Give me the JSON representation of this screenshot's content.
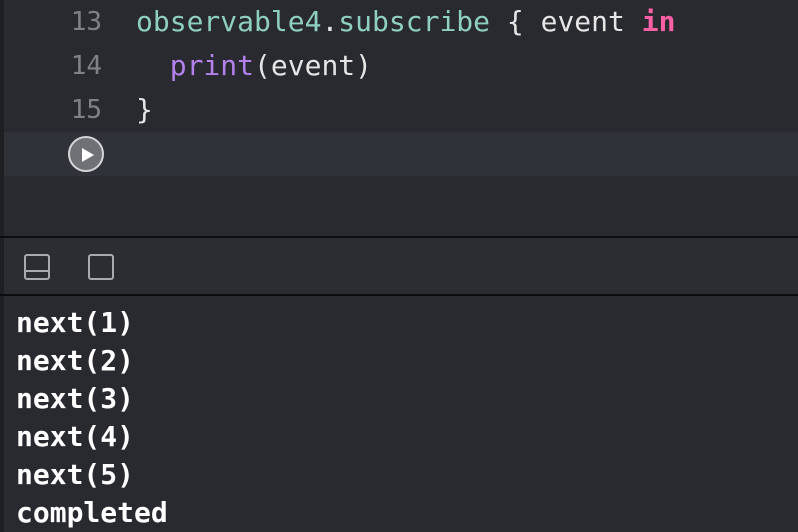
{
  "editor": {
    "lines": [
      {
        "number": "13",
        "tokens": {
          "receiver": "observable4",
          "dot": ".",
          "method": "subscribe",
          "brace": " { event ",
          "keyword": "in"
        }
      },
      {
        "number": "14",
        "tokens": {
          "indent": "  ",
          "func": "print",
          "args": "(event)"
        }
      },
      {
        "number": "15",
        "tokens": {
          "close": "}"
        }
      }
    ],
    "run_button_icon": "play-icon"
  },
  "debug_bar": {
    "hide_debug_icon": "hide-debug-area-icon",
    "toggle_console_icon": "console-panel-icon"
  },
  "console": {
    "output": [
      "next(1)",
      "next(2)",
      "next(3)",
      "next(4)",
      "next(5)",
      "completed"
    ]
  },
  "colors": {
    "background": "#292a30",
    "current_line": "#2f3239",
    "line_number": "#7f8187",
    "identifier_teal": "#8fcfc0",
    "function_purple": "#b281eb",
    "keyword_pink": "#fc5fa3",
    "plain_text": "#e5e5e6",
    "console_text": "#ffffff"
  }
}
